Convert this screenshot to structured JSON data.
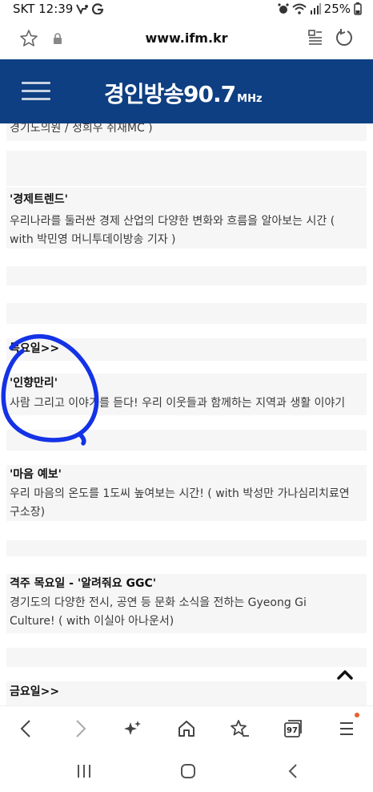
{
  "status": {
    "carrier_time": "SKT 12:39",
    "battery": "25%"
  },
  "browser": {
    "url": "www.ifm.kr",
    "tab_count": "97"
  },
  "site": {
    "logo_main": "경인방송",
    "logo_freq": "90.7",
    "logo_unit": "MHz"
  },
  "content": {
    "line0": "경기도의원 / 정희우 취재MC )",
    "block1_title": "'경제트렌드'",
    "block1_l1": "우리나라를 둘러싼 경제 산업의 다양한 변화와 흐름을 알아보는 시간 (",
    "block1_l2": "with 박민영 머니투데이방송 기자 )",
    "day_thu": "목요일>>",
    "block2_title": "'인향만리'",
    "block2_l1": "사람 그리고 이야기를 듣다! 우리 이웃들과 함께하는 지역과 생활 이야기",
    "block3_title": "'마음 예보'",
    "block3_l1": "우리 마음의 온도를 1도씨 높여보는 시간! ( with 박성만 가나심리치료연",
    "block3_l2": "구소장)",
    "block4_title": "격주 목요일 - '알려줘요 GGC'",
    "block4_l1": "경기도의 다양한 전시, 공연 등 문화 소식을 전하는 Gyeong Gi",
    "block4_l2": "Culture! ( with 이실아 아나운서)",
    "day_fri": "금요일>>"
  },
  "colors": {
    "header_bg": "#0e3f82",
    "annotation": "#1432e6",
    "notification": "#e8612c"
  }
}
